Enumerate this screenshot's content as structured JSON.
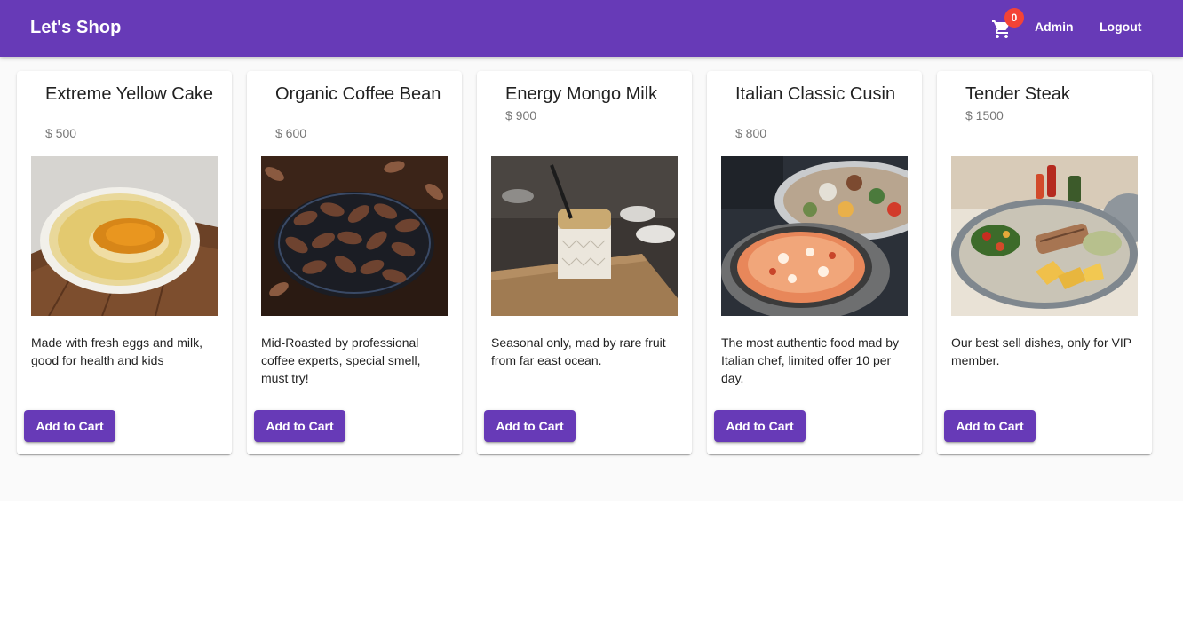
{
  "app": {
    "title": "Let's Shop"
  },
  "nav": {
    "cart_count": "0",
    "admin_label": "Admin",
    "logout_label": "Logout"
  },
  "products": [
    {
      "name": "Extreme Yellow Cake",
      "price": "$ 500",
      "description": "Made with fresh eggs and milk, good for health and kids",
      "button": "Add to Cart"
    },
    {
      "name": "Organic Coffee Bean",
      "price": "$ 600",
      "description": "Mid-Roasted by professional coffee experts, special smell, must try!",
      "button": "Add to Cart"
    },
    {
      "name": "Energy Mongo Milk",
      "price": "$ 900",
      "description": "Seasonal only, mad by rare fruit from far east ocean.",
      "button": "Add to Cart"
    },
    {
      "name": "Italian Classic Cusin",
      "price": "$ 800",
      "description": "The most authentic food mad by Italian chef, limited offer 10 per day.",
      "button": "Add to Cart"
    },
    {
      "name": "Tender Steak",
      "price": "$ 1500",
      "description": "Our best sell dishes, only for VIP member.",
      "button": "Add to Cart"
    }
  ],
  "colors": {
    "primary": "#673ab7",
    "badge": "#f44336",
    "background": "#fafafa"
  }
}
